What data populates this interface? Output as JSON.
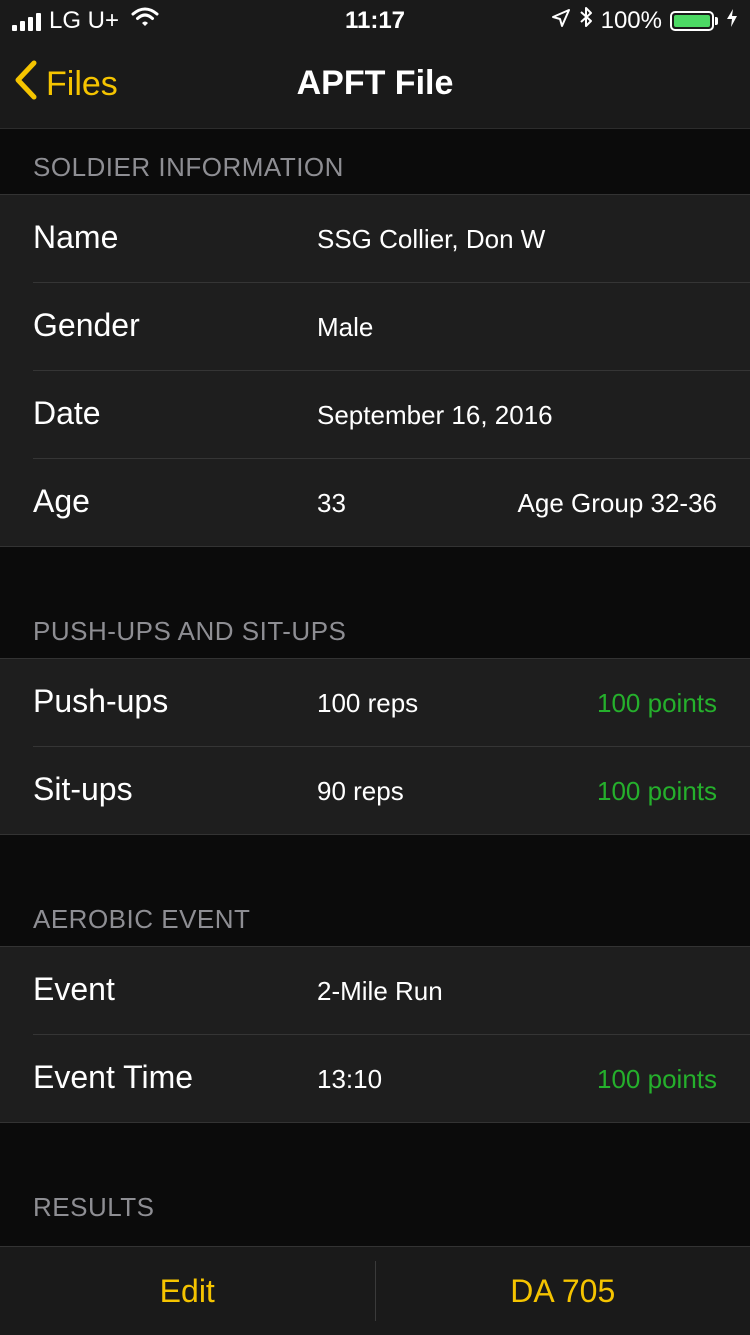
{
  "status_bar": {
    "carrier": "LG U+",
    "time": "11:17",
    "battery_percent": "100%",
    "battery_level": 1.0,
    "icons": [
      "signal-icon",
      "wifi-icon",
      "location-icon",
      "bluetooth-icon",
      "battery-icon",
      "charging-icon"
    ]
  },
  "nav": {
    "back_label": "Files",
    "title": "APFT File"
  },
  "sections": {
    "soldier": {
      "header": "SOLDIER INFORMATION",
      "rows": [
        {
          "label": "Name",
          "value": "SSG Collier, Don W",
          "extra": ""
        },
        {
          "label": "Gender",
          "value": "Male",
          "extra": ""
        },
        {
          "label": "Date",
          "value": "September 16, 2016",
          "extra": ""
        },
        {
          "label": "Age",
          "value": "33",
          "extra": "Age Group 32-36"
        }
      ]
    },
    "pushups_situps": {
      "header": "PUSH-UPS AND SIT-UPS",
      "rows": [
        {
          "label": "Push-ups",
          "value": "100 reps",
          "extra": "100 points"
        },
        {
          "label": "Sit-ups",
          "value": "90 reps",
          "extra": "100 points"
        }
      ]
    },
    "aerobic": {
      "header": "AEROBIC EVENT",
      "rows": [
        {
          "label": "Event",
          "value": "2-Mile Run",
          "extra": ""
        },
        {
          "label": "Event Time",
          "value": "13:10",
          "extra": "100 points"
        }
      ]
    },
    "results": {
      "header": "RESULTS"
    }
  },
  "toolbar": {
    "edit_label": "Edit",
    "form_label": "DA 705"
  },
  "colors": {
    "accent": "#f5c400",
    "points": "#25b02c",
    "background": "#0b0b0b",
    "cell": "#1e1e1e",
    "header_text": "#8e8e93"
  }
}
